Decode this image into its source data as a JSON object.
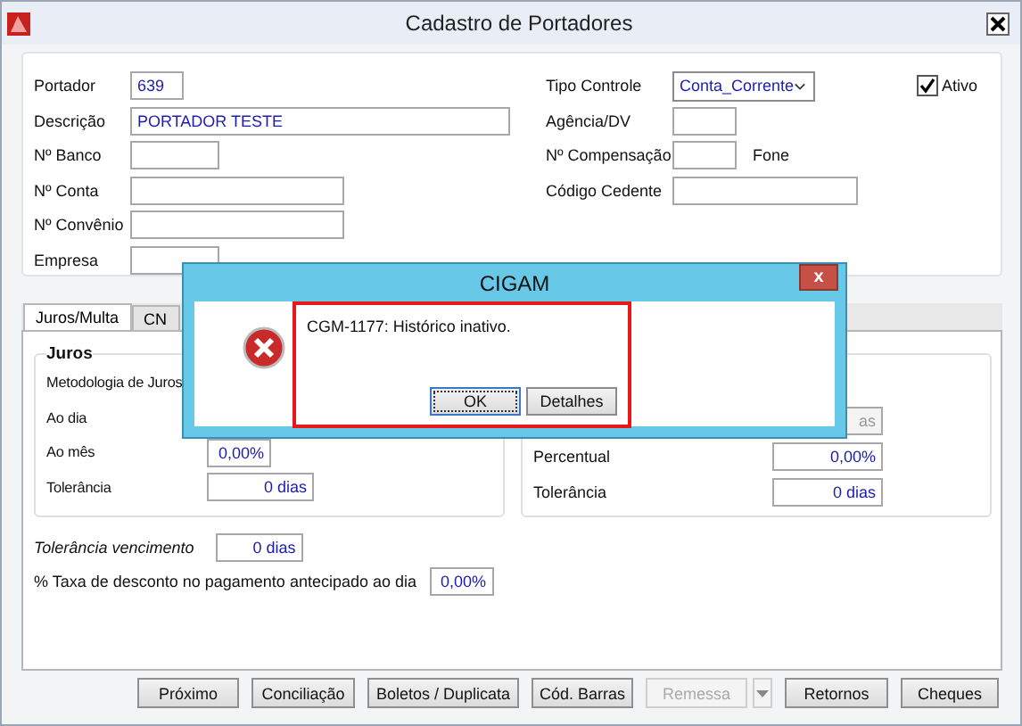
{
  "window": {
    "title": "Cadastro de Portadores"
  },
  "left_fields": [
    {
      "label": "Portador",
      "value": "639"
    },
    {
      "label": "Descrição",
      "value": "PORTADOR TESTE"
    },
    {
      "label": "Nº Banco"
    },
    {
      "label": "Nº Conta"
    },
    {
      "label": "Nº Convênio"
    },
    {
      "label": "Empresa"
    }
  ],
  "tipo_controle": {
    "label": "Tipo Controle",
    "value": "Conta_Corrente"
  },
  "ativo": {
    "label": "Ativo",
    "checked": true
  },
  "right_fields": [
    {
      "label": "Agência/DV"
    },
    {
      "label": "Nº Compensação",
      "extra_label": "Fone"
    },
    {
      "label": "Código Cedente"
    }
  ],
  "tabs": [
    {
      "label": "Juros/Multa",
      "selected": true
    },
    {
      "label": "CN",
      "selected": false
    }
  ],
  "juros": {
    "title": "Juros",
    "rows": [
      {
        "label": "Metodologia de Juros"
      },
      {
        "label": "Ao dia"
      },
      {
        "label": "Ao mês",
        "value": "0,00%"
      },
      {
        "label": "Tolerância",
        "value": "0 dias"
      }
    ]
  },
  "right_group": {
    "rows": [
      {
        "value": "as",
        "disabled": true
      },
      {
        "label": "Percentual",
        "value": "0,00%",
        "disabled": false
      },
      {
        "label": "Tolerância",
        "value": "0 dias",
        "disabled": false
      }
    ]
  },
  "tolerancia_vencimento": {
    "label": "Tolerância vencimento",
    "value": "0 dias"
  },
  "taxa_desconto": {
    "label": "% Taxa de desconto no pagamento antecipado ao dia",
    "value": "0,00%"
  },
  "buttons": [
    {
      "label": "Próximo",
      "disabled": false
    },
    {
      "label": "Conciliação",
      "disabled": false
    },
    {
      "label": "Boletos / Duplicata",
      "disabled": false
    },
    {
      "label": "Cód. Barras",
      "disabled": false
    },
    {
      "label": "Remessa",
      "disabled": true,
      "dropdown": true
    },
    {
      "label": "Retornos",
      "disabled": false
    },
    {
      "label": "Cheques",
      "disabled": false
    }
  ],
  "dialog": {
    "title": "CIGAM",
    "close": "x",
    "message": "CGM-1177: Histórico inativo.",
    "buttons": [
      {
        "label": "OK",
        "focused": true
      },
      {
        "label": "Detalhes",
        "focused": false
      }
    ]
  }
}
